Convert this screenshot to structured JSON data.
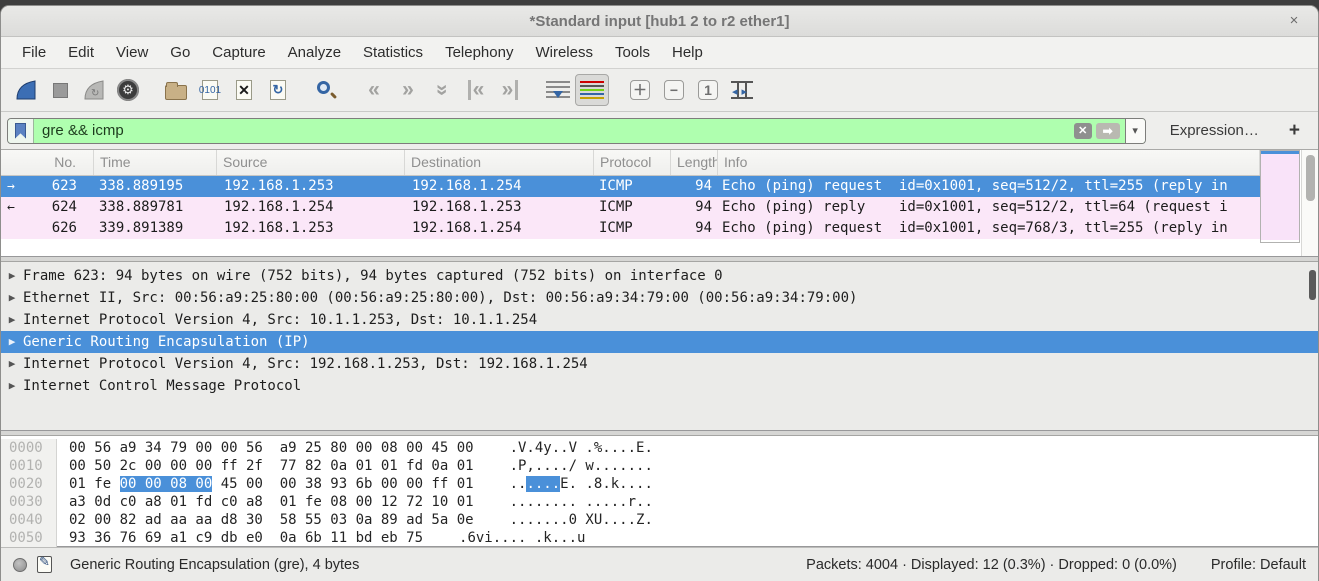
{
  "titlebar": {
    "title": "*Standard input [hub1 2 to r2 ether1]",
    "close": "×"
  },
  "menu": {
    "items": [
      "File",
      "Edit",
      "View",
      "Go",
      "Capture",
      "Analyze",
      "Statistics",
      "Telephony",
      "Wireless",
      "Tools",
      "Help"
    ]
  },
  "toolbar": {
    "icons": [
      {
        "name": "start-capture-icon",
        "gap": false
      },
      {
        "name": "stop-capture-icon",
        "gap": false
      },
      {
        "name": "restart-capture-icon",
        "gap": false
      },
      {
        "name": "capture-options-icon",
        "gap": true
      },
      {
        "name": "open-file-icon",
        "gap": false
      },
      {
        "name": "save-file-icon",
        "gap": false
      },
      {
        "name": "close-file-icon",
        "gap": false
      },
      {
        "name": "reload-file-icon",
        "gap": true
      },
      {
        "name": "find-packet-icon",
        "gap": true
      },
      {
        "name": "go-back-icon",
        "gap": false
      },
      {
        "name": "go-forward-icon",
        "gap": false
      },
      {
        "name": "go-to-packet-icon",
        "gap": false
      },
      {
        "name": "go-first-icon",
        "gap": false
      },
      {
        "name": "go-last-icon",
        "gap": true
      },
      {
        "name": "auto-scroll-icon",
        "gap": false
      },
      {
        "name": "colorize-icon",
        "gap": true,
        "pressed": true
      },
      {
        "name": "zoom-in-icon",
        "gap": false
      },
      {
        "name": "zoom-out-icon",
        "gap": false
      },
      {
        "name": "zoom-100-icon",
        "gap": false
      },
      {
        "name": "resize-columns-icon",
        "gap": false
      }
    ]
  },
  "filter": {
    "value": "gre && icmp",
    "clear_label": "✕",
    "apply_label": "➡",
    "caret": "▾",
    "expression_label": "Expression…",
    "add_label": "+"
  },
  "packet_list": {
    "columns": [
      "No.",
      "Time",
      "Source",
      "Destination",
      "Protocol",
      "Length",
      "Info"
    ],
    "rows": [
      {
        "dir": "→",
        "no": "623",
        "time": "338.889195",
        "src": "192.168.1.253",
        "dst": "192.168.1.254",
        "proto": "ICMP",
        "len": "94",
        "info": "Echo (ping) request  id=0x1001, seq=512/2, ttl=255 (reply in",
        "selected": true
      },
      {
        "dir": "←",
        "no": "624",
        "time": "338.889781",
        "src": "192.168.1.254",
        "dst": "192.168.1.253",
        "proto": "ICMP",
        "len": "94",
        "info": "Echo (ping) reply    id=0x1001, seq=512/2, ttl=64 (request i",
        "selected": false
      },
      {
        "dir": "",
        "no": "626",
        "time": "339.891389",
        "src": "192.168.1.253",
        "dst": "192.168.1.254",
        "proto": "ICMP",
        "len": "94",
        "info": "Echo (ping) request  id=0x1001, seq=768/3, ttl=255 (reply in",
        "selected": false
      }
    ]
  },
  "details": {
    "expander": "▶",
    "rows": [
      {
        "text": "Frame 623: 94 bytes on wire (752 bits), 94 bytes captured (752 bits) on interface 0",
        "selected": false
      },
      {
        "text": "Ethernet II, Src: 00:56:a9:25:80:00 (00:56:a9:25:80:00), Dst: 00:56:a9:34:79:00 (00:56:a9:34:79:00)",
        "selected": false
      },
      {
        "text": "Internet Protocol Version 4, Src: 10.1.1.253, Dst: 10.1.1.254",
        "selected": false
      },
      {
        "text": "Generic Routing Encapsulation (IP)",
        "selected": true
      },
      {
        "text": "Internet Protocol Version 4, Src: 192.168.1.253, Dst: 192.168.1.254",
        "selected": false
      },
      {
        "text": "Internet Control Message Protocol",
        "selected": false
      }
    ]
  },
  "hex": {
    "rows": [
      {
        "offset": "0000",
        "hex": [
          {
            "t": "00 56 a9 34 79 00 00 56  a9 25 80 00 08 00 45 00"
          }
        ],
        "ascii": [
          {
            "t": ".V.4y..V .%....E."
          }
        ]
      },
      {
        "offset": "0010",
        "hex": [
          {
            "t": "00 50 2c 00 00 00 ff 2f  77 82 0a 01 01 fd 0a 01"
          }
        ],
        "ascii": [
          {
            "t": ".P,..../ w......."
          }
        ]
      },
      {
        "offset": "0020",
        "hex": [
          {
            "t": "01 fe "
          },
          {
            "t": "00 00 08 00",
            "hl": true
          },
          {
            "t": " 45 00  00 38 93 6b 00 00 ff 01"
          }
        ],
        "ascii": [
          {
            "t": ".."
          },
          {
            "t": "....",
            "hl": true
          },
          {
            "t": "E. .8.k...."
          }
        ]
      },
      {
        "offset": "0030",
        "hex": [
          {
            "t": "a3 0d c0 a8 01 fd c0 a8  01 fe 08 00 12 72 10 01"
          }
        ],
        "ascii": [
          {
            "t": "........ .....r.."
          }
        ]
      },
      {
        "offset": "0040",
        "hex": [
          {
            "t": "02 00 82 ad aa aa d8 30  58 55 03 0a 89 ad 5a 0e"
          }
        ],
        "ascii": [
          {
            "t": ".......0 XU....Z."
          }
        ]
      },
      {
        "offset": "0050",
        "hex": [
          {
            "t": "93 36 76 69 a1 c9 db e0  0a 6b 11 bd eb 75"
          }
        ],
        "ascii": [
          {
            "t": ".6vi.... .k...u"
          }
        ]
      }
    ]
  },
  "statusbar": {
    "field_info": "Generic Routing Encapsulation (gre), 4 bytes",
    "packets_info": "Packets: 4004 · Displayed: 12 (0.3%) · Dropped: 0 (0.0%)",
    "profile": "Profile: Default"
  },
  "colors": {
    "selection_blue": "#4a90d9",
    "icmp_row_pink": "#fbe7f8",
    "filter_valid_green": "#afffaf",
    "backdrop": "#3e3e3e"
  }
}
